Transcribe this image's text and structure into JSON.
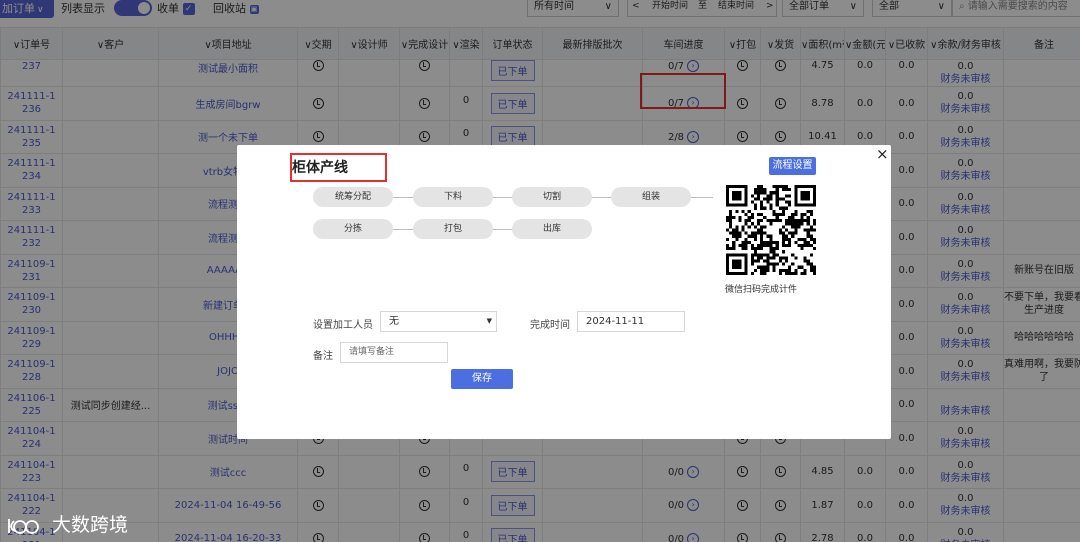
{
  "toolbar": {
    "add_order": "加订单",
    "list_view": "列表显示",
    "collect": "收单",
    "recycle": "回收站",
    "time_filter": "所有时间",
    "start_time": "开始时间",
    "to": "至",
    "end_time": "结束时间",
    "order_filter": "全部订单",
    "all_filter": "全部",
    "search_placeholder": "请输入需要搜索的内容"
  },
  "table": {
    "headers": [
      "订单号",
      "客户",
      "项目地址",
      "交期",
      "设计师",
      "完成设计",
      "渲染",
      "订单状态",
      "最新排版批次",
      "车间进度",
      "打包",
      "发货",
      "面积(m²)",
      "金额(元)",
      "已收款",
      "余款/财务审核",
      "备注"
    ],
    "rows": [
      {
        "no": [
          "237"
        ],
        "customer": "",
        "addr": "测试最小面积",
        "render": "",
        "status": "已下单",
        "progress": "0/7",
        "area": "4.75",
        "amount": "0.0",
        "received": "0.0",
        "balance": "0.0",
        "fin": "财务未审核",
        "note": ""
      },
      {
        "no": [
          "241111-1",
          "236"
        ],
        "customer": "",
        "addr": "生成房间bgrw",
        "render": "0",
        "status": "已下单",
        "progress": "0/7",
        "area": "8.78",
        "amount": "0.0",
        "received": "0.0",
        "balance": "0.0",
        "fin": "财务未审核",
        "note": ""
      },
      {
        "no": [
          "241111-1",
          "235"
        ],
        "customer": "",
        "addr": "测一个未下单",
        "render": "0",
        "status": "已下单",
        "progress": "2/8",
        "area": "10.41",
        "amount": "0.0",
        "received": "0.0",
        "balance": "0.0",
        "fin": "财务未审核",
        "note": ""
      },
      {
        "no": [
          "241111-1",
          "234"
        ],
        "customer": "",
        "addr": "vtrb女特价",
        "render": "",
        "status": "",
        "progress": "",
        "area": "",
        "amount": "",
        "received": "0.0",
        "balance": "0.0",
        "fin": "财务未审核",
        "note": ""
      },
      {
        "no": [
          "241111-1",
          "233"
        ],
        "customer": "",
        "addr": "流程测试",
        "render": "",
        "status": "",
        "progress": "",
        "area": "",
        "amount": "",
        "received": "0.0",
        "balance": "0.0",
        "fin": "财务未审核",
        "note": ""
      },
      {
        "no": [
          "241111-1",
          "232"
        ],
        "customer": "",
        "addr": "流程测试",
        "render": "",
        "status": "",
        "progress": "",
        "area": "",
        "amount": "",
        "received": "0.0",
        "balance": "0.0",
        "fin": "财务未审核",
        "note": ""
      },
      {
        "no": [
          "241109-1",
          "231"
        ],
        "customer": "",
        "addr": "AAAAAA",
        "render": "",
        "status": "",
        "progress": "",
        "area": "",
        "amount": "",
        "received": "0.0",
        "balance": "0.0",
        "fin": "财务未审核",
        "note": "新账号在旧版"
      },
      {
        "no": [
          "241109-1",
          "230"
        ],
        "customer": "",
        "addr": "新建订单不",
        "render": "",
        "status": "",
        "progress": "",
        "area": "",
        "amount": "",
        "received": "0.0",
        "balance": "0.0",
        "fin": "财务未审核",
        "note": "不要下单，我要看生产进度"
      },
      {
        "no": [
          "241109-1",
          "229"
        ],
        "customer": "",
        "addr": "OHHHH",
        "render": "",
        "status": "",
        "progress": "",
        "area": "",
        "amount": "",
        "received": "0.0",
        "balance": "0.0",
        "fin": "财务未审核",
        "note": "哈哈哈哈哈哈"
      },
      {
        "no": [
          "241109-1",
          "228"
        ],
        "customer": "",
        "addr": "JOJO",
        "render": "",
        "status": "",
        "progress": "",
        "area": "",
        "amount": "",
        "received": "0.0",
        "balance": "0.0",
        "fin": "财务未审核",
        "note": "真难用啊，我要防了"
      },
      {
        "no": [
          "241106-1",
          "225"
        ],
        "customer": "测试同步创建经...",
        "addr": "测试ssss",
        "render": "",
        "status": "",
        "progress": "",
        "area": "",
        "amount": "",
        "received": "0.0",
        "balance": "",
        "fin": "财务未审核",
        "note": ""
      },
      {
        "no": [
          "241104-1",
          "224"
        ],
        "customer": "",
        "addr": "测试时间",
        "render": "",
        "status": "",
        "progress": "",
        "area": "",
        "amount": "",
        "received": "0.0",
        "balance": "0.0",
        "fin": "财务未审核",
        "note": ""
      },
      {
        "no": [
          "241104-1",
          "223"
        ],
        "customer": "",
        "addr": "测试ccc",
        "render": "0",
        "status": "已下单",
        "progress": "0/0",
        "area": "4.85",
        "amount": "0.0",
        "received": "0.0",
        "balance": "0.0",
        "fin": "财务未审核",
        "note": ""
      },
      {
        "no": [
          "241104-1",
          "222"
        ],
        "customer": "",
        "addr": "2024-11-04 16-49-56",
        "render": "0",
        "status": "已下单",
        "progress": "0/0",
        "area": "1.87",
        "amount": "0.0",
        "received": "0.0",
        "balance": "0.0",
        "fin": "财务未审核",
        "note": ""
      },
      {
        "no": [
          "241104-1",
          "221"
        ],
        "customer": "",
        "addr": "2024-11-04 16-20-33",
        "render": "0",
        "status": "已下单",
        "progress": "0/0",
        "area": "2.78",
        "amount": "0.0",
        "received": "0.0",
        "balance": "0.0",
        "fin": "财务未审核",
        "note": ""
      }
    ]
  },
  "modal": {
    "title": "柜体产线",
    "close": "×",
    "flow_settings": "流程设置",
    "steps": [
      "统筹分配",
      "下料",
      "切割",
      "组装",
      "分拣",
      "打包",
      "出库"
    ],
    "qr_caption": "微信扫码完成计件",
    "worker_label": "设置加工人员",
    "worker_value": "无",
    "finish_label": "完成时间",
    "finish_value": "2024-11-11",
    "remark_label": "备注",
    "remark_placeholder": "请填写备注",
    "save": "保存"
  },
  "watermark": "大数跨境",
  "colors": {
    "accent": "#4b6fe0",
    "highlight": "#e53030",
    "link": "#4b59d0"
  }
}
